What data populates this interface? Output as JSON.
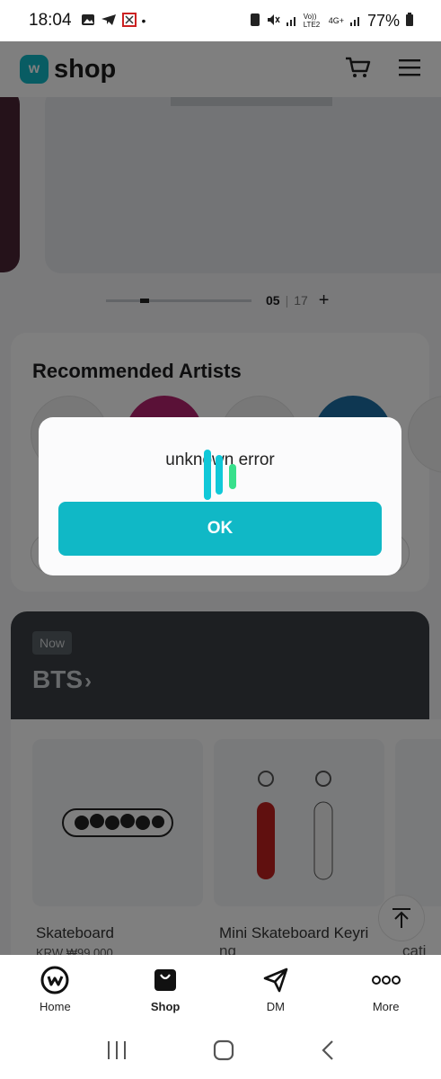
{
  "status_bar": {
    "time": "18:04",
    "network_volte": "Vo)) LTE2",
    "network_type": "4G+",
    "battery": "77%"
  },
  "header": {
    "logo_letter": "w",
    "logo_text": "shop"
  },
  "banner_pager": {
    "current": "05",
    "total": "17",
    "more": "+"
  },
  "recommended": {
    "title": "Recommended Artists"
  },
  "now": {
    "tag": "Now",
    "artist": "BTS"
  },
  "products": [
    {
      "name": "Skateboard",
      "price": "KRW ₩99,000"
    },
    {
      "name": "Mini Skateboard Keyri",
      "name_wrap": "ng"
    },
    {
      "name": "cati"
    }
  ],
  "dialog": {
    "message": "unknown error",
    "ok_label": "OK"
  },
  "bottom_nav": {
    "items": [
      {
        "label": "Home",
        "icon": "weverse-icon"
      },
      {
        "label": "Shop",
        "icon": "shop-bag-icon"
      },
      {
        "label": "DM",
        "icon": "send-icon"
      },
      {
        "label": "More",
        "icon": "more-dots-icon"
      }
    ],
    "active": "Shop"
  },
  "colors": {
    "accent": "#10b8c6",
    "spinner_teal": "#10c8d8",
    "spinner_green": "#38e08c",
    "overlay": "rgba(0,0,0,0.5)"
  }
}
